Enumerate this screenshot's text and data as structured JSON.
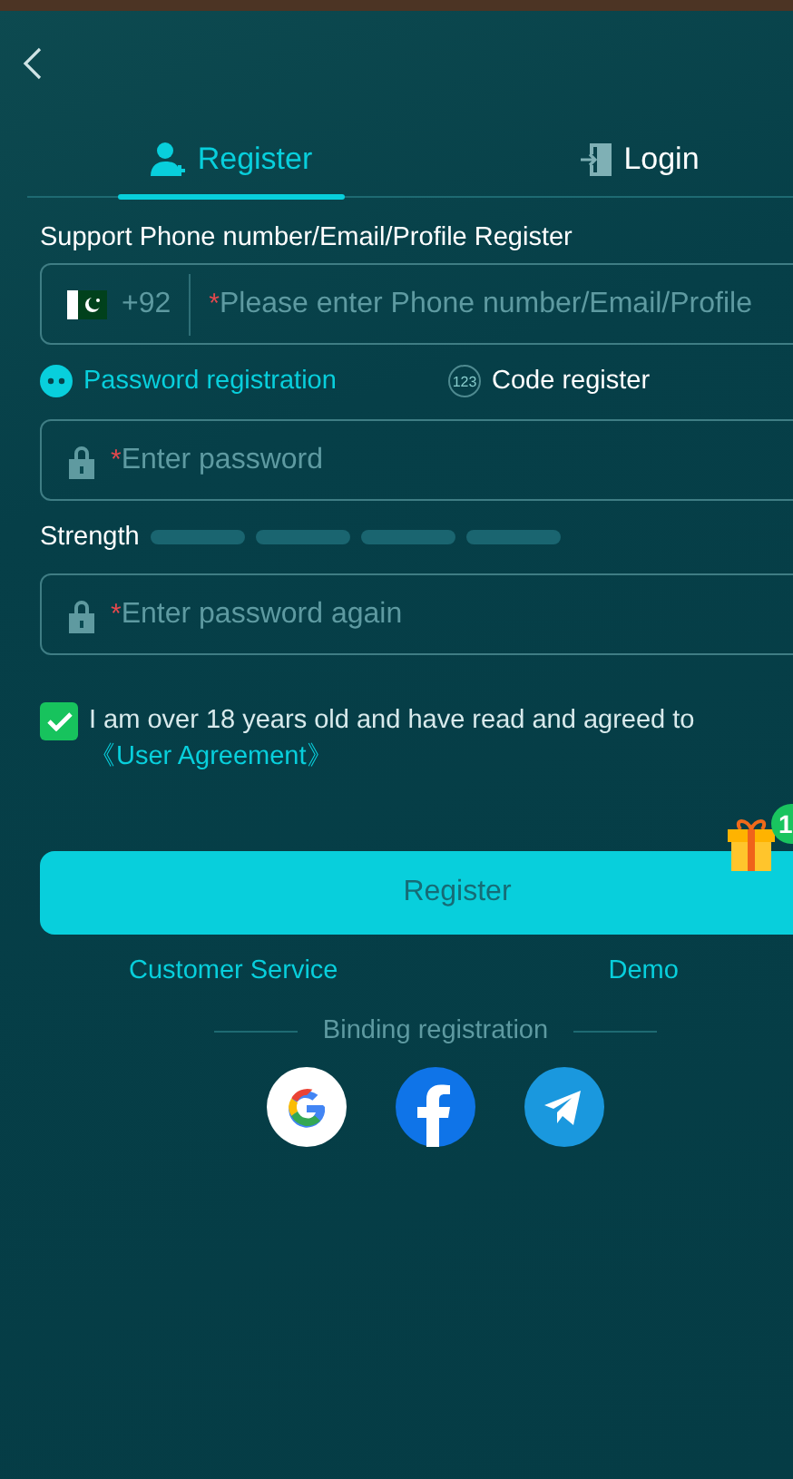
{
  "tabs": [
    {
      "label": "Register",
      "selected": true,
      "kind": "register"
    },
    {
      "label": "Login",
      "selected": false,
      "kind": "login"
    }
  ],
  "account": {
    "label": "Support Phone number/Email/Profile Register",
    "country_code": "+92",
    "required_mark": "*",
    "placeholder": "Please enter Phone number/Email/Profile"
  },
  "modes": [
    {
      "label": "Password registration",
      "selected": true,
      "kind": "password"
    },
    {
      "label": "Code register",
      "selected": false,
      "kind": "code",
      "icon_text": "123"
    }
  ],
  "password": {
    "required_mark": "*",
    "placeholder": "Enter password"
  },
  "strength": {
    "label": "Strength"
  },
  "confirm": {
    "required_mark": "*",
    "placeholder": "Enter password again"
  },
  "agreement": {
    "checked": true,
    "text": "I am over 18 years old and have read and agreed to ",
    "link": "《User Agreement》"
  },
  "gift": {
    "badge": "1"
  },
  "submit": "Register",
  "links": [
    "Customer Service",
    "Demo"
  ],
  "binding": "Binding registration"
}
